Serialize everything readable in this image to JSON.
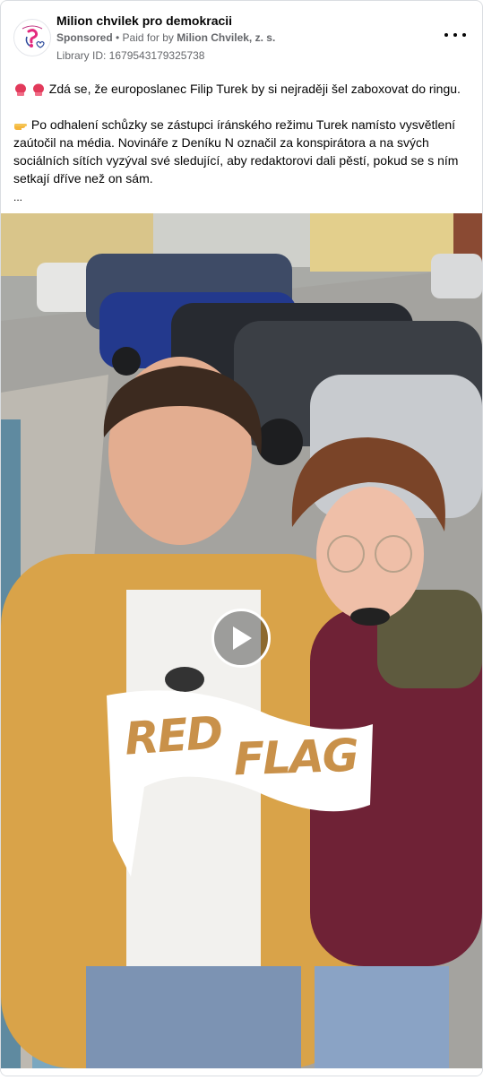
{
  "post": {
    "page_name": "Milion chvilek pro demokracii",
    "sponsored": "Sponsored",
    "paid_prefix": " • Paid for by ",
    "paid_by": "Milion Chvilek, z. s.",
    "library_id": "Library ID: 1679543179325738",
    "text_line1": "Zdá se, že europoslanec Filip Turek by si nejraději šel zaboxovat do ringu.",
    "text_p2_l1": "Po odhalení schůzky se zástupci íránského režimu Turek namísto vysvětlení",
    "text_p2_l2": "zaútočil na média. Novináře z Deníku N označil za konspirátora a na svých",
    "text_p2_l3": "sociálních sítích vyzýval své sledující, aby redaktorovi dali pěstí, pokud se s ním",
    "text_p2_l4": "setkají dříve než on sám.",
    "ellipsis": "..."
  },
  "media": {
    "overlay_word1": "RED",
    "overlay_word2": "FLAG"
  },
  "icons": {
    "avatar": "milion-chvilek-logo",
    "boxing_gloves": "boxing-glove-emoji",
    "pointing": "pointing-right-emoji",
    "play": "play-icon",
    "more": "more-options-icon"
  },
  "colors": {
    "text": "#050505",
    "secondary": "#65676b",
    "logo_pink": "#e3297d",
    "logo_blue": "#2d4b9c",
    "flag_fill": "#ffffff"
  }
}
